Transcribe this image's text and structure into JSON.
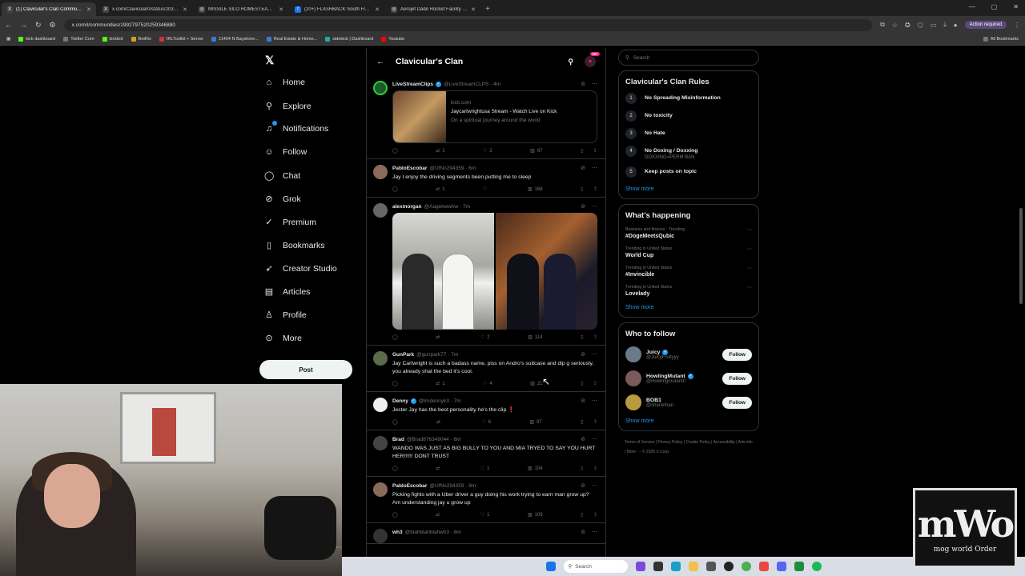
{
  "browser": {
    "tabs": [
      {
        "title": "(1) Clavicular's Clan Community",
        "icon": "x-icon"
      },
      {
        "title": "x.com/Clavicular0/status/20391...",
        "icon": "x-icon"
      },
      {
        "title": "MISSILE SILO HOMESTEAD - G...",
        "icon": "globe-icon"
      },
      {
        "title": "(20+) FLASHBACK South Florid...",
        "icon": "facebook-icon"
      },
      {
        "title": "Aerojet Dade Rocket Facility | A...",
        "icon": "globe-icon"
      }
    ],
    "url": "x.com/i/communities/1992797520259346880",
    "action_required": "Action required",
    "bookmarks": [
      "kick dashboard",
      "Twitter Com",
      "kickbot",
      "BotRix",
      "IRLToolkit + Server",
      "11404 N Bayshore...",
      "Real Estate & Home...",
      "sidekick | Dashboard",
      "Youtube"
    ],
    "all_bookmarks": "All Bookmarks"
  },
  "nav": {
    "items": [
      "Home",
      "Explore",
      "Notifications",
      "Follow",
      "Chat",
      "Grok",
      "Premium",
      "Bookmarks",
      "Creator Studio",
      "Articles",
      "Profile",
      "More"
    ],
    "post": "Post"
  },
  "community": {
    "title": "Clavicular's Clan",
    "badge": "20+"
  },
  "tweets": [
    {
      "name": "LiveStreamClips",
      "handle": "@LiveStreamCLPS · 4m",
      "verified": true,
      "text": "",
      "card": {
        "domain": "kick.com",
        "title": "Jaycartwrightusa Stream - Watch Live on Kick",
        "desc": "On a spiritual journey around the world"
      },
      "reposts": "1",
      "likes": "2",
      "views": "67"
    },
    {
      "name": "PabloEscobar",
      "handle": "@UfNo294359 · 6m",
      "text": "Jay I enjoy the driving segments been putting me to sleep",
      "reposts": "1",
      "likes": "",
      "views": "168"
    },
    {
      "name": "alexmorgan",
      "handle": "@Aagekwwhw · 7m",
      "text": "",
      "reposts": "",
      "likes": "2",
      "views": "114"
    },
    {
      "name": "GunPark",
      "handle": "@gunpark77 · 7m",
      "text": "Jay Cartwright is such a badass name, piss on Andro's suitcase and dip g seriously, you already shat the bed it's cool.",
      "reposts": "1",
      "likes": "4",
      "views": "21"
    },
    {
      "name": "Denny",
      "handle": "@lmdennyk3 · 7m",
      "verified": true,
      "text": "Jester Jay has the best personality he's the clip",
      "reposts": "",
      "likes": "6",
      "views": "97"
    },
    {
      "name": "Brad",
      "handle": "@Brad876349044 · 8m",
      "text": "WANDO WAS JUST AS BIG BULLY TO YOU AND MIA TRYED TO SAY YOU HURT HER!!!!!! DONT TRUST",
      "reposts": "",
      "likes": "1",
      "views": "104"
    },
    {
      "name": "PabloEscobar",
      "handle": "@UfNo294359 · 8m",
      "text": "Picking fights with a Uber driver a guy doing his work trying to earn man grow up? Am understanding jay u grow up",
      "reposts": "",
      "likes": "1",
      "views": "109"
    },
    {
      "name": "wh3",
      "handle": "@blahblahblahwh3 · 8m",
      "text": "",
      "reposts": "",
      "likes": "",
      "views": ""
    }
  ],
  "right": {
    "search_placeholder": "Search",
    "rules_title": "Clavicular's Clan Rules",
    "rules": [
      {
        "n": "1",
        "t": "No Spreading Misinformation",
        "s": ""
      },
      {
        "n": "2",
        "t": "No toxicity",
        "s": ""
      },
      {
        "n": "3",
        "t": "No Hate",
        "s": ""
      },
      {
        "n": "4",
        "t": "No Doxing / Doxxing",
        "s": "DOXXING=PERM BAN"
      },
      {
        "n": "5",
        "t": "Keep posts on topic",
        "s": ""
      }
    ],
    "show_more": "Show more",
    "happening_title": "What's happening",
    "trends": [
      {
        "meta": "Business and finance · Trending",
        "topic": "#DogeMeetsQubic"
      },
      {
        "meta": "Trending in United States",
        "topic": "World Cup"
      },
      {
        "meta": "Trending in United States",
        "topic": "#Invincible"
      },
      {
        "meta": "Trending in United States",
        "topic": "Lovelady"
      }
    ],
    "wtf_title": "Who to follow",
    "follow_label": "Follow",
    "wtf": [
      {
        "name": "Juicy",
        "handle": "@JuicyFruityyy",
        "verified": true
      },
      {
        "name": "HowlingMutant",
        "handle": "@Howlingmutant0",
        "verified": true
      },
      {
        "name": "BOB1",
        "handle": "@shanetrian",
        "verified": false
      }
    ],
    "footer": "Terms of Service | Privacy Policy | Cookie Policy | Accessibility | Ads info | More ··· © 2026 X Corp."
  },
  "taskbar": {
    "search": "Search"
  },
  "overlay": {
    "big": "mWo",
    "small": "mog world Order"
  }
}
